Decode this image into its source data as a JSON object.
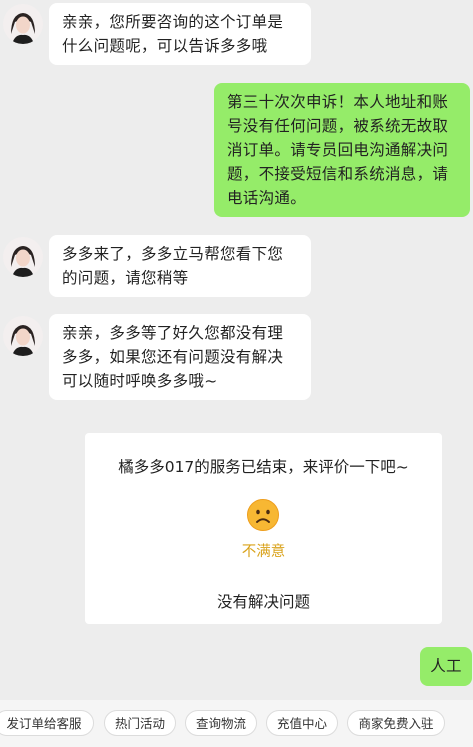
{
  "messages": [
    {
      "from": "agent",
      "lines": [
        "亲亲，您所要咨询的这个订单是",
        "什么问题呢，可以告诉多多哦"
      ]
    },
    {
      "from": "user",
      "lines": [
        "第三十次次申诉！本人地址和账",
        "号没有任何问题，被系统无故取",
        "消订单。请专员回电沟通解决问",
        "题，不接受短信和系统消息，请",
        "电话沟通。"
      ]
    },
    {
      "from": "agent",
      "lines": [
        "多多来了，多多立马帮您看下您",
        "的问题，请您稍等"
      ]
    },
    {
      "from": "agent",
      "lines": [
        "亲亲，多多等了好久您都没有理",
        "多多，如果您还有问题没有解决",
        "可以随时呼唤多多哦~"
      ]
    }
  ],
  "rating_card": {
    "title": "橘多多017的服务已结束，来评价一下吧~",
    "face_icon": "sad-face-icon",
    "rating_label": "不满意",
    "reason": "没有解决问题"
  },
  "user_last": "人工",
  "quick_actions": [
    "发订单给客服",
    "热门活动",
    "查询物流",
    "充值中心",
    "商家免费入驻"
  ],
  "colors": {
    "user_bubble": "#95ec69",
    "agent_bubble": "#ffffff",
    "rating": "#d9a21a",
    "background": "#ededed"
  }
}
